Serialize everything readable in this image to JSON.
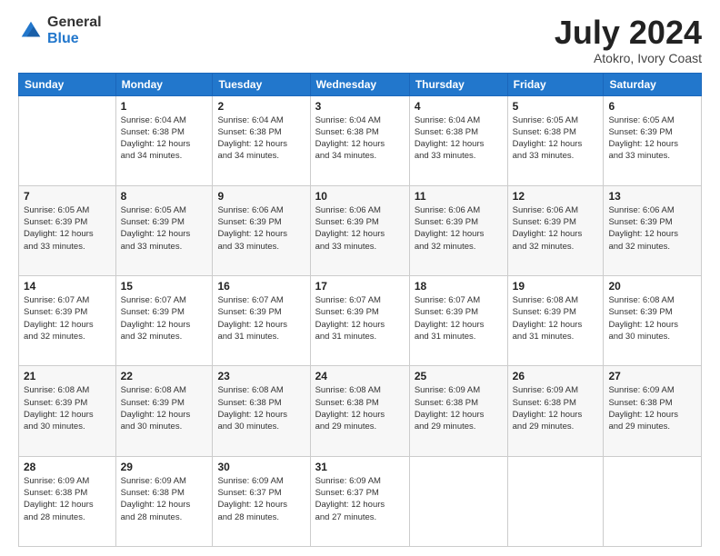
{
  "logo": {
    "general": "General",
    "blue": "Blue"
  },
  "title": {
    "month_year": "July 2024",
    "location": "Atokro, Ivory Coast"
  },
  "days_of_week": [
    "Sunday",
    "Monday",
    "Tuesday",
    "Wednesday",
    "Thursday",
    "Friday",
    "Saturday"
  ],
  "weeks": [
    [
      {
        "day": "",
        "info": ""
      },
      {
        "day": "1",
        "info": "Sunrise: 6:04 AM\nSunset: 6:38 PM\nDaylight: 12 hours\nand 34 minutes."
      },
      {
        "day": "2",
        "info": "Sunrise: 6:04 AM\nSunset: 6:38 PM\nDaylight: 12 hours\nand 34 minutes."
      },
      {
        "day": "3",
        "info": "Sunrise: 6:04 AM\nSunset: 6:38 PM\nDaylight: 12 hours\nand 34 minutes."
      },
      {
        "day": "4",
        "info": "Sunrise: 6:04 AM\nSunset: 6:38 PM\nDaylight: 12 hours\nand 33 minutes."
      },
      {
        "day": "5",
        "info": "Sunrise: 6:05 AM\nSunset: 6:38 PM\nDaylight: 12 hours\nand 33 minutes."
      },
      {
        "day": "6",
        "info": "Sunrise: 6:05 AM\nSunset: 6:39 PM\nDaylight: 12 hours\nand 33 minutes."
      }
    ],
    [
      {
        "day": "7",
        "info": ""
      },
      {
        "day": "8",
        "info": "Sunrise: 6:05 AM\nSunset: 6:39 PM\nDaylight: 12 hours\nand 33 minutes."
      },
      {
        "day": "9",
        "info": "Sunrise: 6:06 AM\nSunset: 6:39 PM\nDaylight: 12 hours\nand 33 minutes."
      },
      {
        "day": "10",
        "info": "Sunrise: 6:06 AM\nSunset: 6:39 PM\nDaylight: 12 hours\nand 33 minutes."
      },
      {
        "day": "11",
        "info": "Sunrise: 6:06 AM\nSunset: 6:39 PM\nDaylight: 12 hours\nand 32 minutes."
      },
      {
        "day": "12",
        "info": "Sunrise: 6:06 AM\nSunset: 6:39 PM\nDaylight: 12 hours\nand 32 minutes."
      },
      {
        "day": "13",
        "info": "Sunrise: 6:06 AM\nSunset: 6:39 PM\nDaylight: 12 hours\nand 32 minutes."
      }
    ],
    [
      {
        "day": "14",
        "info": ""
      },
      {
        "day": "15",
        "info": "Sunrise: 6:07 AM\nSunset: 6:39 PM\nDaylight: 12 hours\nand 32 minutes."
      },
      {
        "day": "16",
        "info": "Sunrise: 6:07 AM\nSunset: 6:39 PM\nDaylight: 12 hours\nand 31 minutes."
      },
      {
        "day": "17",
        "info": "Sunrise: 6:07 AM\nSunset: 6:39 PM\nDaylight: 12 hours\nand 31 minutes."
      },
      {
        "day": "18",
        "info": "Sunrise: 6:07 AM\nSunset: 6:39 PM\nDaylight: 12 hours\nand 31 minutes."
      },
      {
        "day": "19",
        "info": "Sunrise: 6:08 AM\nSunset: 6:39 PM\nDaylight: 12 hours\nand 31 minutes."
      },
      {
        "day": "20",
        "info": "Sunrise: 6:08 AM\nSunset: 6:39 PM\nDaylight: 12 hours\nand 30 minutes."
      }
    ],
    [
      {
        "day": "21",
        "info": ""
      },
      {
        "day": "22",
        "info": "Sunrise: 6:08 AM\nSunset: 6:39 PM\nDaylight: 12 hours\nand 30 minutes."
      },
      {
        "day": "23",
        "info": "Sunrise: 6:08 AM\nSunset: 6:38 PM\nDaylight: 12 hours\nand 30 minutes."
      },
      {
        "day": "24",
        "info": "Sunrise: 6:08 AM\nSunset: 6:38 PM\nDaylight: 12 hours\nand 29 minutes."
      },
      {
        "day": "25",
        "info": "Sunrise: 6:09 AM\nSunset: 6:38 PM\nDaylight: 12 hours\nand 29 minutes."
      },
      {
        "day": "26",
        "info": "Sunrise: 6:09 AM\nSunset: 6:38 PM\nDaylight: 12 hours\nand 29 minutes."
      },
      {
        "day": "27",
        "info": "Sunrise: 6:09 AM\nSunset: 6:38 PM\nDaylight: 12 hours\nand 29 minutes."
      }
    ],
    [
      {
        "day": "28",
        "info": "Sunrise: 6:09 AM\nSunset: 6:38 PM\nDaylight: 12 hours\nand 28 minutes."
      },
      {
        "day": "29",
        "info": "Sunrise: 6:09 AM\nSunset: 6:38 PM\nDaylight: 12 hours\nand 28 minutes."
      },
      {
        "day": "30",
        "info": "Sunrise: 6:09 AM\nSunset: 6:37 PM\nDaylight: 12 hours\nand 28 minutes."
      },
      {
        "day": "31",
        "info": "Sunrise: 6:09 AM\nSunset: 6:37 PM\nDaylight: 12 hours\nand 27 minutes."
      },
      {
        "day": "",
        "info": ""
      },
      {
        "day": "",
        "info": ""
      },
      {
        "day": "",
        "info": ""
      }
    ]
  ],
  "week7_sunday": {
    "info": "Sunrise: 6:05 AM\nSunset: 6:39 PM\nDaylight: 12 hours\nand 33 minutes."
  },
  "week14_sunday": {
    "info": "Sunrise: 6:07 AM\nSunset: 6:39 PM\nDaylight: 12 hours\nand 32 minutes."
  },
  "week21_sunday": {
    "info": "Sunrise: 6:08 AM\nSunset: 6:39 PM\nDaylight: 12 hours\nand 30 minutes."
  }
}
